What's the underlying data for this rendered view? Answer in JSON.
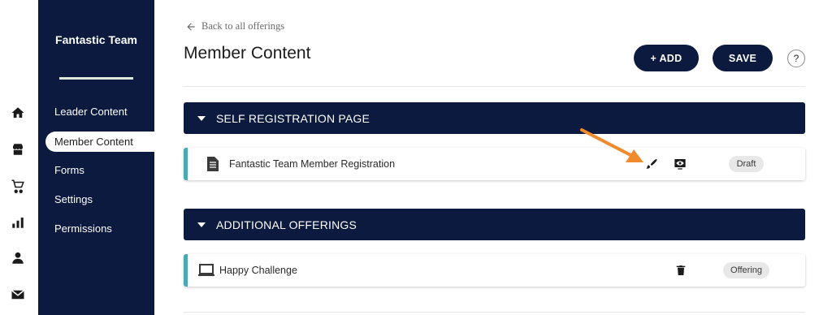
{
  "rail": {
    "icons": [
      "home-icon",
      "store-icon",
      "cart-icon",
      "chart-icon",
      "person-icon",
      "mail-icon"
    ]
  },
  "sidebar": {
    "team_name": "Fantastic Team",
    "items": [
      {
        "label": "Leader Content",
        "active": false
      },
      {
        "label": "Member Content",
        "active": true
      },
      {
        "label": "Forms",
        "active": false
      },
      {
        "label": "Settings",
        "active": false
      },
      {
        "label": "Permissions",
        "active": false
      }
    ]
  },
  "header": {
    "back_label": "Back to all offerings",
    "title": "Member Content",
    "add_label": "+ ADD",
    "save_label": "SAVE",
    "help_label": "?"
  },
  "sections": [
    {
      "title": "SELF REGISTRATION PAGE",
      "rows": [
        {
          "icon": "document-icon",
          "title": "Fantastic Team Member Registration",
          "actions": [
            "paintbrush-icon",
            "preview-icon"
          ],
          "status": "Draft"
        }
      ]
    },
    {
      "title": "ADDITIONAL OFFERINGS",
      "rows": [
        {
          "icon": "laptop-icon",
          "title": "Happy Challenge",
          "actions": [
            "trash-icon"
          ],
          "status": "Offering"
        }
      ]
    }
  ],
  "colors": {
    "navy": "#0c1a3f",
    "accent_teal": "#4aa9b0",
    "callout_orange": "#f08a2c",
    "badge_bg": "#e8e8e8"
  }
}
